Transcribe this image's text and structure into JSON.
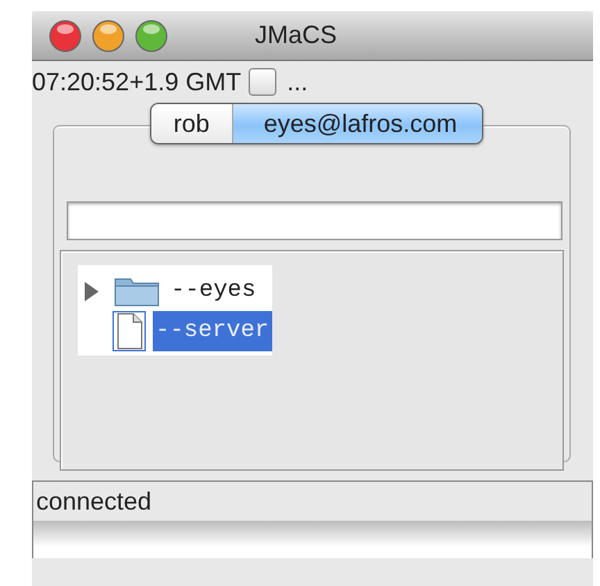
{
  "window": {
    "title": "JMaCS"
  },
  "toolbar": {
    "time": "07:20:52+1.9 GMT",
    "checkbox": {
      "checked": false
    },
    "more": "..."
  },
  "tabs": [
    {
      "label": "rob",
      "selected": false
    },
    {
      "label": "eyes@lafros.com",
      "selected": true
    }
  ],
  "tree": [
    {
      "label": "--eyes",
      "kind": "folder",
      "expanded": false,
      "selected": false
    },
    {
      "label": "--server",
      "kind": "file",
      "selected": true
    }
  ],
  "status": "connected"
}
